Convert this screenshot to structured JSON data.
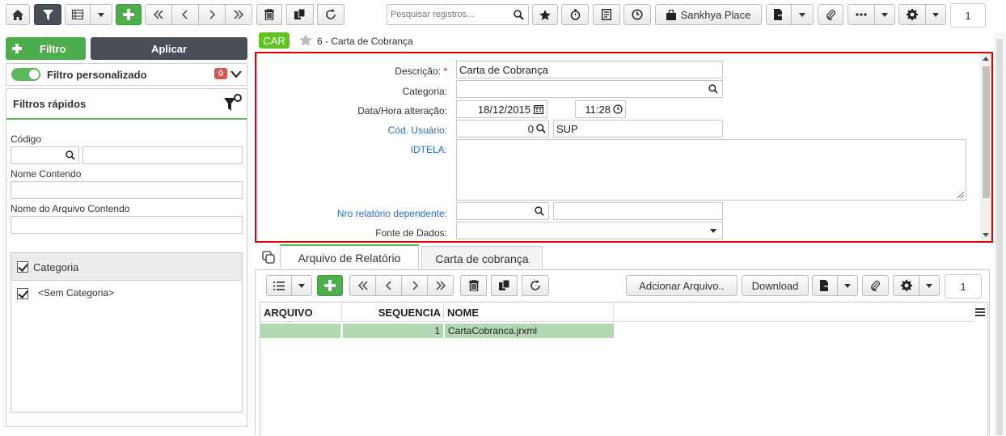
{
  "toolbar": {
    "search_placeholder": "Pesquisar registros...",
    "place_label": "Sankhya Place",
    "page_number": "1"
  },
  "left": {
    "filtro_label": "Filtro",
    "aplicar_label": "Aplicar",
    "filtro_personalizado": "Filtro personalizado",
    "filtro_count": "0",
    "filtros_rapidos": "Filtros rápidos",
    "codigo_label": "Código",
    "nome_contendo_label": "Nome Contendo",
    "nome_arquivo_label": "Nome do Arquivo Contendo",
    "categoria_header": "Categoria",
    "categoria_items": [
      "<Sem Categoria>"
    ]
  },
  "record": {
    "badge": "CAR",
    "title": "6 - Carta de Cobrança"
  },
  "form": {
    "descricao_label": "Descrição:",
    "descricao_value": "Carta de Cobrança",
    "categoria_label": "Categoria:",
    "data_label": "Data/Hora alteração:",
    "data_value": "18/12/2015",
    "hora_value": "11:28",
    "usuario_label": "Cód. Usuário:",
    "usuario_code": "0",
    "usuario_name": "SUP",
    "idtela_label": "IDTELA:",
    "nro_label": "Nro relatório dependente:",
    "fonte_label": "Fonte de Dados:"
  },
  "tabs": [
    "Arquivo de Relatório",
    "Carta de cobrança"
  ],
  "detail_toolbar": {
    "adicionar_label": "Adcionar Arquivo..",
    "download_label": "Download",
    "page_number": "1"
  },
  "grid": {
    "columns": [
      "ARQUIVO",
      "SEQUENCIA",
      "NOME"
    ],
    "rows": [
      {
        "arquivo": "",
        "sequencia": "1",
        "nome": "CartaCobranca.jrxml"
      }
    ]
  },
  "colors": {
    "accent_green": "#5cb85c",
    "highlight_red": "#e00000",
    "dark": "#4a4f57"
  }
}
